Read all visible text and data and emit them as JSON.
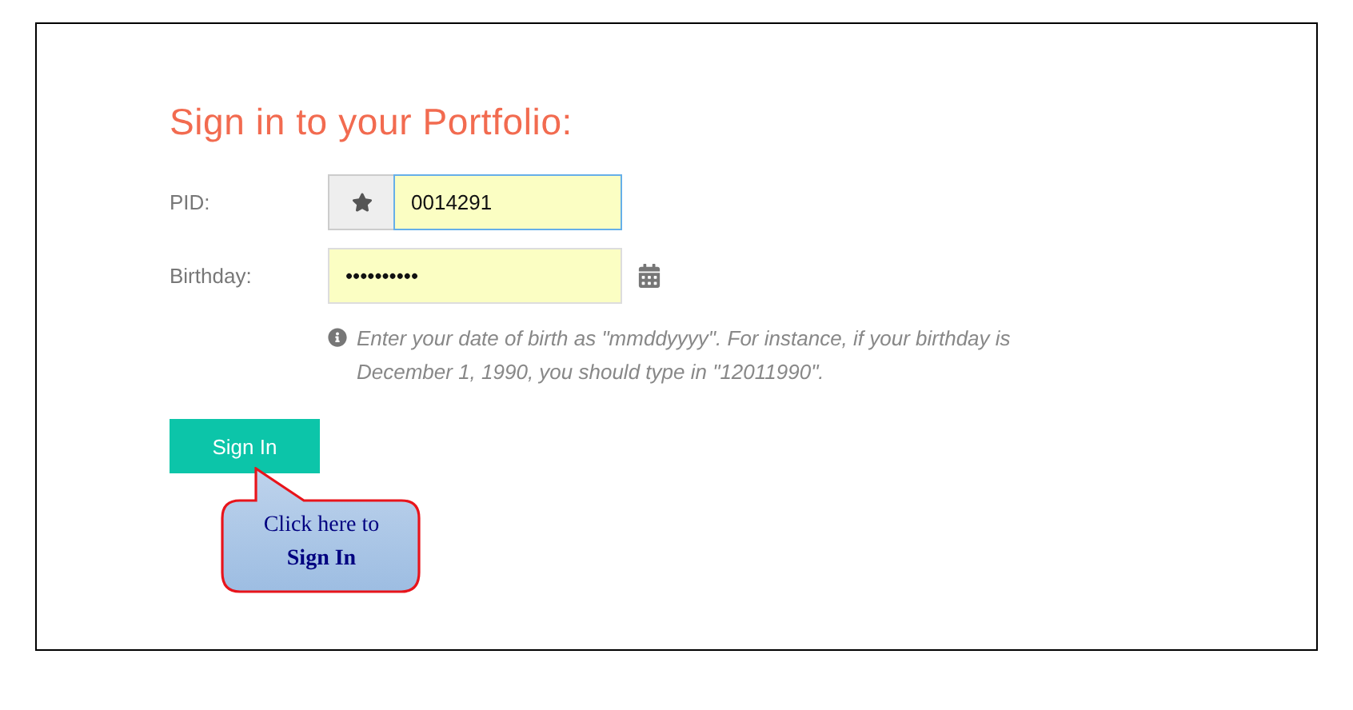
{
  "title": "Sign in to your Portfolio:",
  "fields": [
    {
      "kind": "pid",
      "label": "PID:",
      "value": "0014291",
      "focused": true
    },
    {
      "kind": "birthday",
      "label": "Birthday:",
      "value": "••••••••••",
      "focused": false
    }
  ],
  "hint": "Enter your date of birth as \"mmddyyyy\". For instance, if your birthday is December 1, 1990, you should type in \"12011990\".",
  "button": "Sign In",
  "callout": "Click here to **Sign In**"
}
